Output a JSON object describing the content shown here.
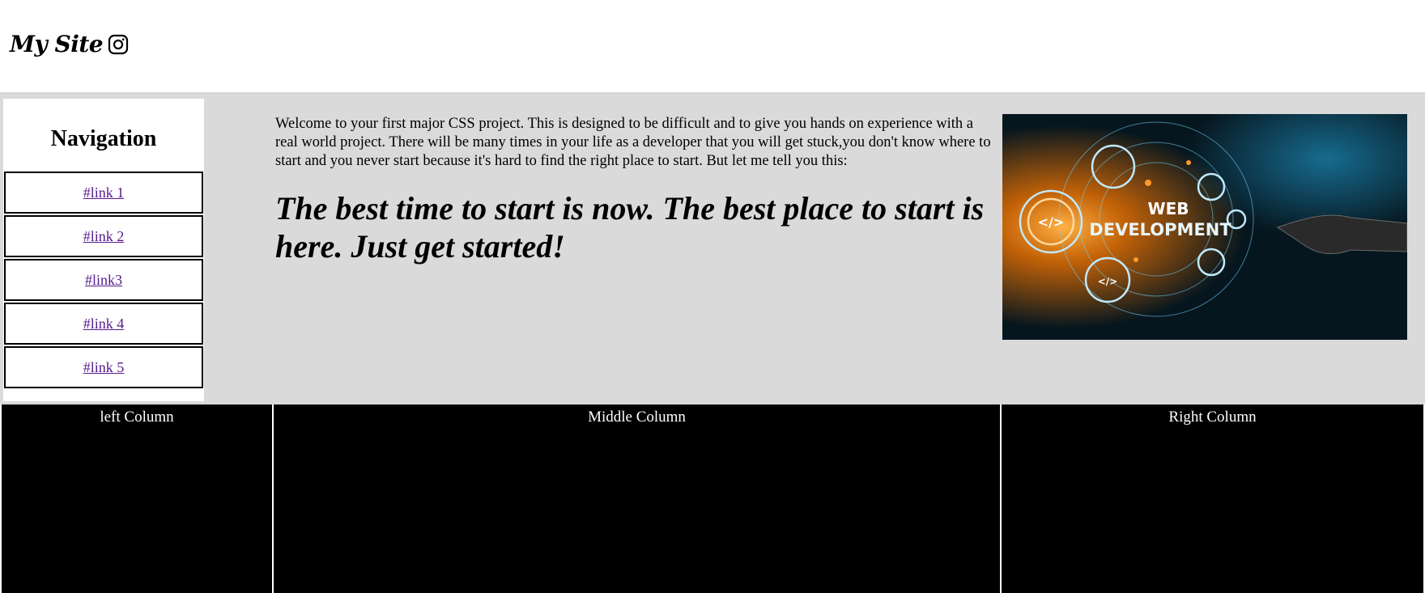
{
  "header": {
    "logo_text": "My Site",
    "logo_icon": "instagram-icon"
  },
  "nav": {
    "title": "Navigation",
    "links": [
      "#link 1",
      "#link 2",
      "#link3",
      "#link 4",
      "#link 5"
    ],
    "link_color": "#551a8b"
  },
  "content": {
    "intro": "Welcome to your first major CSS project. This is designed to be difficult and to give you hands on experience with a real world project. There will be many times in your life as a developer that you will get stuck,you don't know where to start and you never start because it's hard to find the right place to start. But let me tell you this:",
    "headline": "The best time to start is now. The best place to start is here. Just get started!",
    "hero_text_line1": "WEB",
    "hero_text_line2": "DEVELOPMENT"
  },
  "columns": {
    "left": "left Column",
    "middle": "Middle Column",
    "right": "Right Column"
  },
  "colors": {
    "main_bg": "#dadada",
    "column_bg": "#000000",
    "hero_accent": "#ff8a1a",
    "hero_cyan": "#6fd3ff"
  }
}
